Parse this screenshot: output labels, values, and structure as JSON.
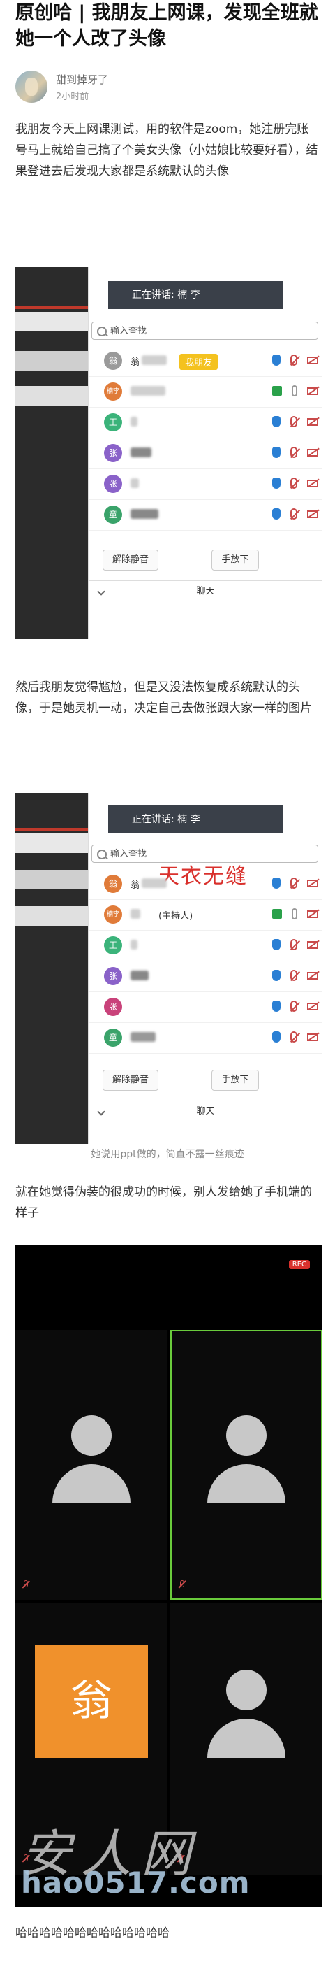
{
  "article": {
    "title": "原创哈 | 我朋友上网课，发现全班就她一个人改了头像",
    "author": "甜到掉牙了",
    "time": "2小时前",
    "paragraph1": "我朋友今天上网课测试，用的软件是zoom，她注册完账号马上就给自己搞了个美女头像（小姑娘比较要好看），结果登进去后发现大家都是系统默认的头像",
    "paragraph2": "然后我朋友觉得尴尬，但是又没法恢复成系统默认的头像，于是她灵机一动，决定自己去做张跟大家一样的图片",
    "caption2": "她说用ppt做的，简直不露一丝痕迹",
    "paragraph3": "就在她觉得伪装的很成功的时候，别人发给她了手机端的样子",
    "paragraph4": "哈哈哈哈哈哈哈哈哈哈哈哈哈"
  },
  "screenshot1": {
    "speaking_label": "正在讲话: 楠 李",
    "search_placeholder": "输入查找",
    "friend_badge": "我朋友",
    "participants": [
      {
        "avatar": "翁",
        "name": "翁",
        "color": "#9a9a9a"
      },
      {
        "avatar": "楠李",
        "name": "",
        "color": "#e07b39"
      },
      {
        "avatar": "王",
        "name": "",
        "color": "#3bb37a"
      },
      {
        "avatar": "张",
        "name": "",
        "color": "#8a62c9"
      },
      {
        "avatar": "张",
        "name": "",
        "color": "#8a62c9"
      },
      {
        "avatar": "童",
        "name": "",
        "color": "#3aa36a"
      }
    ],
    "unmute_all": "解除静音",
    "lower_hands": "手放下",
    "chat": "聊天"
  },
  "screenshot2": {
    "speaking_label": "正在讲话: 楠 李",
    "search_placeholder": "输入查找",
    "overlay_text": "天衣无缝",
    "participants": [
      {
        "avatar": "翁",
        "name": "翁",
        "color": "#e07b39"
      },
      {
        "avatar": "楠李",
        "name": "(主持人)",
        "color": "#e07b39"
      },
      {
        "avatar": "王",
        "name": "",
        "color": "#3bb37a"
      },
      {
        "avatar": "张",
        "name": "",
        "color": "#8a62c9"
      },
      {
        "avatar": "张",
        "name": "",
        "color": "#c9427a"
      },
      {
        "avatar": "童",
        "name": "",
        "color": "#3aa36a"
      }
    ],
    "unmute_all": "解除静音",
    "lower_hands": "手放下",
    "chat": "聊天"
  },
  "phone": {
    "rec_label": "REC",
    "orange_avatar": "翁"
  },
  "watermark": {
    "line1": "安人网",
    "line2": "hao0517.com"
  }
}
